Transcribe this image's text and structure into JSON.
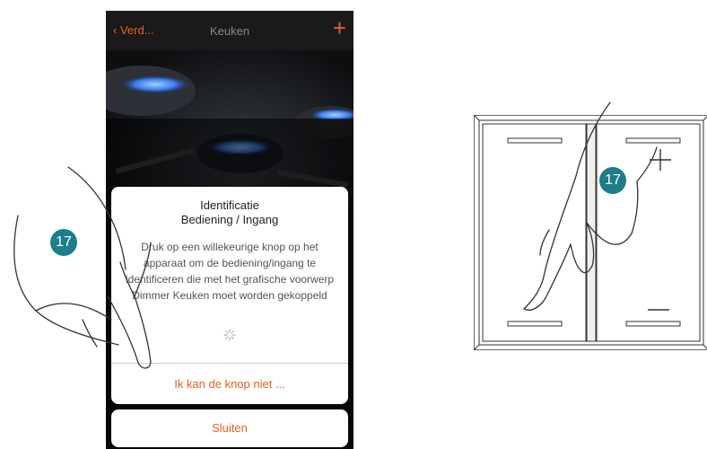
{
  "navbar": {
    "back_label": "Verd...",
    "title": "Keuken",
    "add_label": "+"
  },
  "dialog": {
    "title_line1": "Identificatie",
    "title_line2": "Bediening / Ingang",
    "message": "Druk op een willekeurige knop op het apparaat om de bediening/ingang te identificeren die met het grafische voorwerp Dimmer Keuken moet worden gekoppeld",
    "action_label": "Ik kan de knop niet ..."
  },
  "close_label": "Sluiten",
  "step_badges": [
    "17",
    "17"
  ],
  "colors": {
    "accent": "#e8601c",
    "badge": "#1c7e8a",
    "nav_bg": "#1a1a1a"
  }
}
